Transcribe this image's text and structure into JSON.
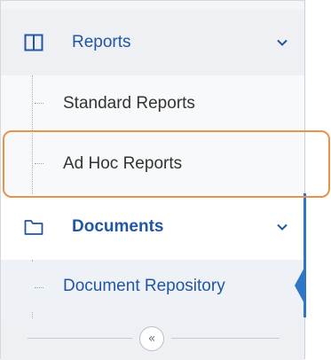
{
  "sidebar": {
    "sections": [
      {
        "label": "Reports",
        "icon": "columns-icon",
        "expanded": true,
        "items": [
          {
            "label": "Standard Reports"
          },
          {
            "label": "Ad Hoc Reports",
            "highlighted": true
          }
        ]
      },
      {
        "label": "Documents",
        "icon": "folder-icon",
        "expanded": true,
        "active": true,
        "items": [
          {
            "label": "Document Repository",
            "active": true
          }
        ]
      }
    ],
    "collapse_glyph": "«"
  },
  "colors": {
    "accent": "#2156a5",
    "active_indicator": "#2f76c6",
    "highlight": "#e8924a"
  }
}
